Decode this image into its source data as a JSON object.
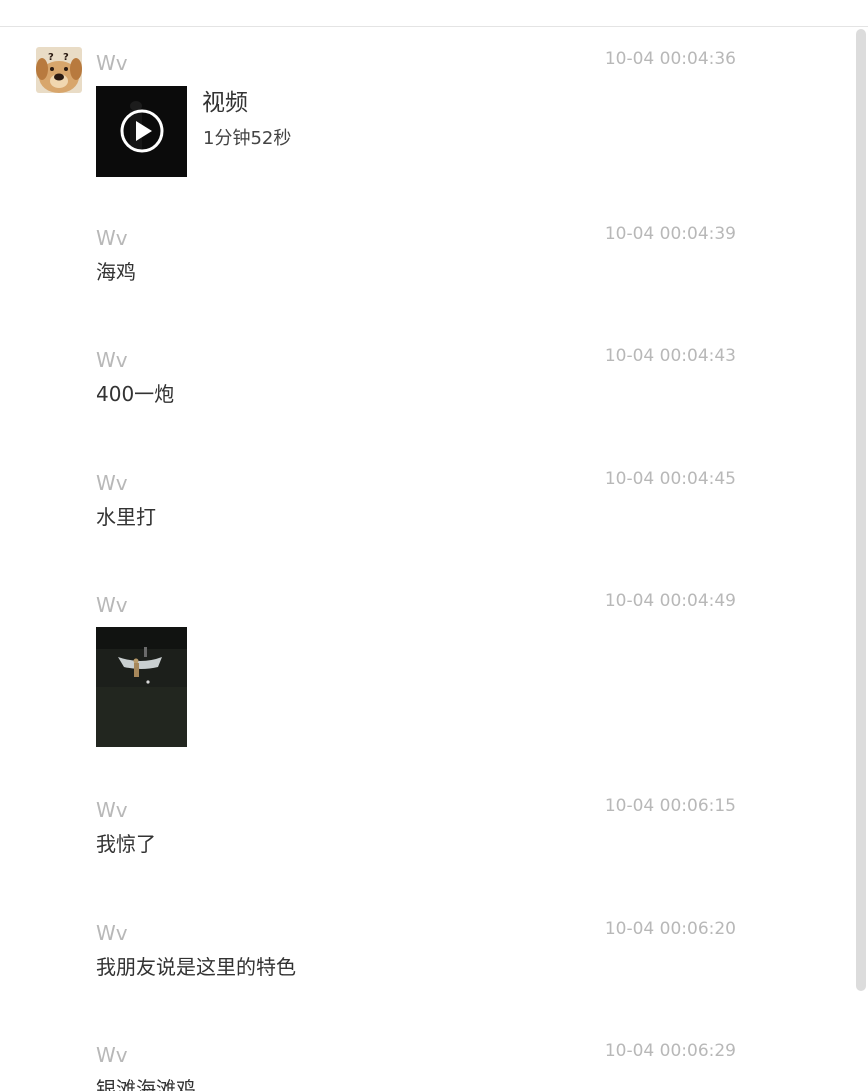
{
  "messages": [
    {
      "sender": "Wv",
      "time": "10-04 00:04:36",
      "type": "video",
      "video": {
        "title": "视频",
        "duration": "1分钟52秒"
      }
    },
    {
      "sender": "Wv",
      "time": "10-04 00:04:39",
      "type": "text",
      "text": "海鸡"
    },
    {
      "sender": "Wv",
      "time": "10-04 00:04:43",
      "type": "text",
      "text": "400一炮"
    },
    {
      "sender": "Wv",
      "time": "10-04 00:04:45",
      "type": "text",
      "text": "水里打"
    },
    {
      "sender": "Wv",
      "time": "10-04 00:04:49",
      "type": "image"
    },
    {
      "sender": "Wv",
      "time": "10-04 00:06:15",
      "type": "text",
      "text": "我惊了"
    },
    {
      "sender": "Wv",
      "time": "10-04 00:06:20",
      "type": "text",
      "text": "我朋友说是这里的特色"
    },
    {
      "sender": "Wv",
      "time": "10-04 00:06:29",
      "type": "text",
      "text": "银滩海滩鸡"
    }
  ],
  "icons": {
    "avatar": "cartoon-dog-avatar",
    "video_play": "play-icon"
  },
  "colors": {
    "meta_text": "#b8b8b8",
    "body_text": "#333333",
    "background": "#ffffff"
  }
}
